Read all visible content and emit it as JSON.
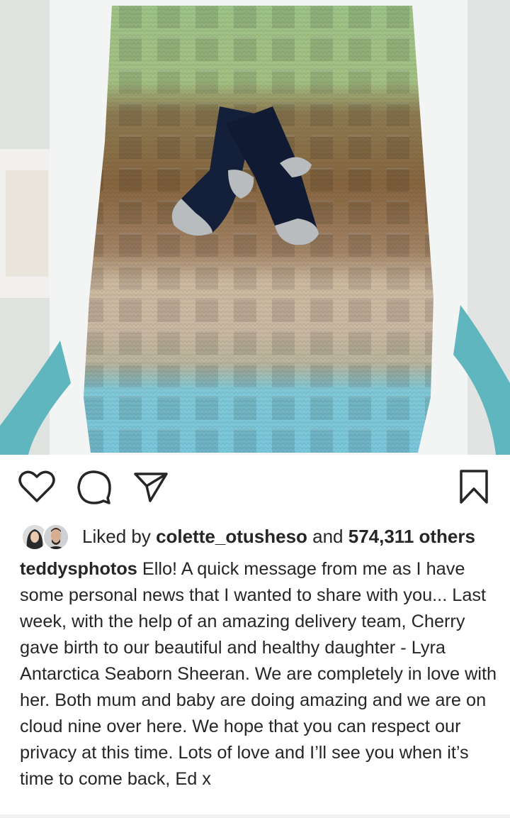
{
  "post": {
    "image_alt": "Knitted blanket in green, brown, beige and blue stripes with a pair of navy baby socks",
    "actions": {
      "like_icon": "heart-outline-icon",
      "comment_icon": "comment-bubble-icon",
      "share_icon": "paper-plane-icon",
      "save_icon": "bookmark-outline-icon"
    },
    "likes": {
      "prefix": "Liked by ",
      "user": "colette_otusheso",
      "middle": " and ",
      "count": "574,311 others"
    },
    "caption": {
      "username": "teddysphotos",
      "text": " Ello! A quick message from me as I have some personal news that I wanted to share with you... Last week, with the help of an amazing delivery team, Cherry gave birth to our beautiful and healthy daughter - Lyra Antarctica Seaborn Sheeran. We are completely in love with her. Both mum and baby are doing amazing and we are on cloud nine over here. We hope that you can respect our privacy at this time. Lots of love and I’ll see you when it’s time to come back, Ed x"
    }
  },
  "colors": {
    "text": "#262626",
    "blanket_green": "#9fc38a",
    "blanket_brown": "#8a6a48",
    "blanket_beige": "#c8b59b",
    "blanket_blue": "#7fc9d9",
    "sock_navy": "#14203a",
    "sock_grey": "#b9bcbe"
  }
}
